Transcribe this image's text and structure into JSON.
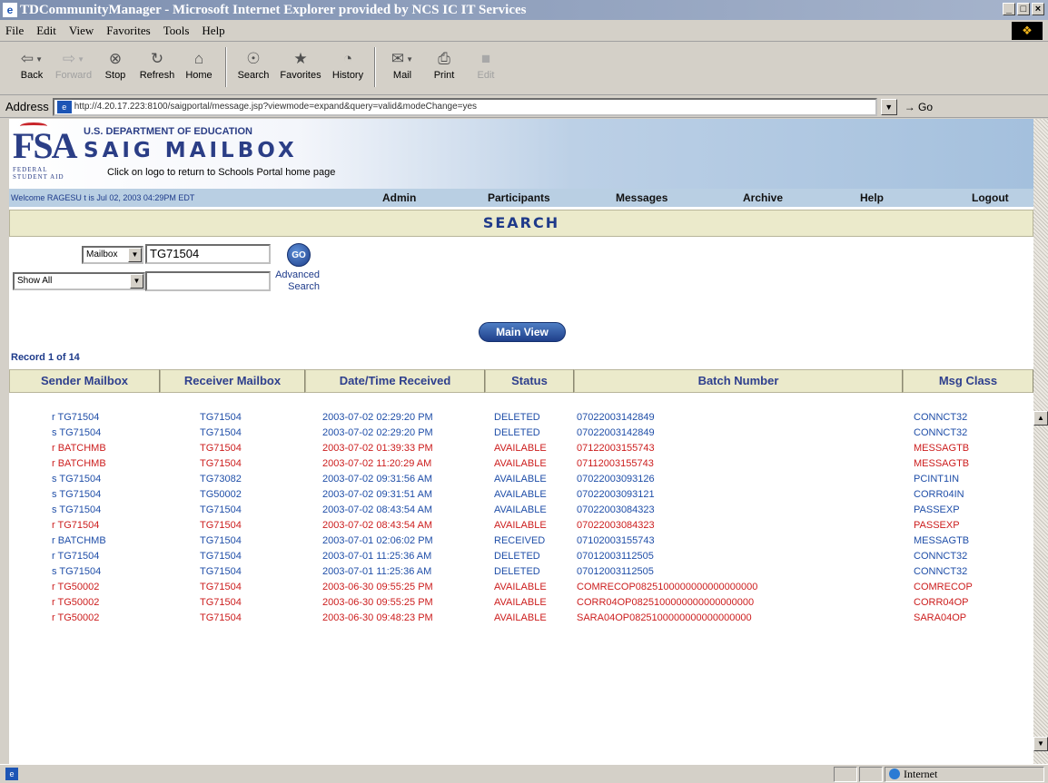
{
  "window": {
    "title": "TDCommunityManager - Microsoft Internet Explorer provided by NCS IC IT Services",
    "buttons": [
      "_",
      "□",
      "×"
    ]
  },
  "menu": [
    "File",
    "Edit",
    "View",
    "Favorites",
    "Tools",
    "Help"
  ],
  "toolbar": {
    "back": "Back",
    "forward": "Forward",
    "stop": "Stop",
    "refresh": "Refresh",
    "home": "Home",
    "search": "Search",
    "favorites": "Favorites",
    "history": "History",
    "mail": "Mail",
    "print": "Print",
    "edit": "Edit"
  },
  "address": {
    "label": "Address",
    "url": "http://4.20.17.223:8100/saigportal/message.jsp?viewmode=expand&query=valid&modeChange=yes",
    "go": "Go"
  },
  "banner": {
    "logo_big": "FSA",
    "logo_small": "FEDERAL STUDENT AID",
    "dept": "U.S. DEPARTMENT OF EDUCATION",
    "title": "SAIG MAILBOX",
    "subtitle": "Click on logo to return to Schools Portal home page"
  },
  "nav": {
    "welcome": "Welcome RAGESU    t is Jul 02, 2003 04:29PM EDT",
    "items": [
      "Admin",
      "Participants",
      "Messages",
      "Archive",
      "Help",
      "Logout"
    ]
  },
  "search": {
    "heading": "SEARCH",
    "mailbox_select": "Mailbox",
    "mailbox_value": "TG71504",
    "go": "GO",
    "filter_select": "Show All",
    "filter_value": "",
    "advanced": "Advanced Search",
    "main_view": "Main View"
  },
  "record_label": "Record 1 of 14",
  "table": {
    "headers": [
      "Sender Mailbox",
      "Receiver Mailbox",
      "Date/Time Received",
      "Status",
      "Batch Number",
      "Msg Class"
    ],
    "rows": [
      {
        "color": "blue",
        "cells": [
          "r TG71504",
          "TG71504",
          "2003-07-02 02:29:20 PM",
          "DELETED",
          "07022003142849",
          "CONNCT32"
        ]
      },
      {
        "color": "blue",
        "cells": [
          "s TG71504",
          "TG71504",
          "2003-07-02 02:29:20 PM",
          "DELETED",
          "07022003142849",
          "CONNCT32"
        ]
      },
      {
        "color": "red",
        "cells": [
          "r BATCHMB",
          "TG71504",
          "2003-07-02 01:39:33 PM",
          "AVAILABLE",
          "07122003155743",
          "MESSAGTB"
        ]
      },
      {
        "color": "red",
        "cells": [
          "r BATCHMB",
          "TG71504",
          "2003-07-02 11:20:29 AM",
          "AVAILABLE",
          "07112003155743",
          "MESSAGTB"
        ]
      },
      {
        "color": "blue",
        "cells": [
          "s TG71504",
          "TG73082",
          "2003-07-02 09:31:56 AM",
          "AVAILABLE",
          "07022003093126",
          "PCINT1IN"
        ]
      },
      {
        "color": "blue",
        "cells": [
          "s TG71504",
          "TG50002",
          "2003-07-02 09:31:51 AM",
          "AVAILABLE",
          "07022003093121",
          "CORR04IN"
        ]
      },
      {
        "color": "blue",
        "cells": [
          "s TG71504",
          "TG71504",
          "2003-07-02 08:43:54 AM",
          "AVAILABLE",
          "07022003084323",
          "PASSEXP"
        ]
      },
      {
        "color": "red",
        "cells": [
          "r TG71504",
          "TG71504",
          "2003-07-02 08:43:54 AM",
          "AVAILABLE",
          "07022003084323",
          "PASSEXP"
        ]
      },
      {
        "color": "blue",
        "cells": [
          "r BATCHMB",
          "TG71504",
          "2003-07-01 02:06:02 PM",
          "RECEIVED",
          "07102003155743",
          "MESSAGTB"
        ]
      },
      {
        "color": "blue",
        "cells": [
          "r TG71504",
          "TG71504",
          "2003-07-01 11:25:36 AM",
          "DELETED",
          "07012003112505",
          "CONNCT32"
        ]
      },
      {
        "color": "blue",
        "cells": [
          "s TG71504",
          "TG71504",
          "2003-07-01 11:25:36 AM",
          "DELETED",
          "07012003112505",
          "CONNCT32"
        ]
      },
      {
        "color": "red",
        "cells": [
          "r TG50002",
          "TG71504",
          "2003-06-30 09:55:25 PM",
          "AVAILABLE",
          "COMRECOP0825100000000000000000",
          "COMRECOP"
        ]
      },
      {
        "color": "red",
        "cells": [
          "r TG50002",
          "TG71504",
          "2003-06-30 09:55:25 PM",
          "AVAILABLE",
          "CORR04OP0825100000000000000000",
          "CORR04OP"
        ]
      },
      {
        "color": "red",
        "cells": [
          "r TG50002",
          "TG71504",
          "2003-06-30 09:48:23 PM",
          "AVAILABLE",
          "SARA04OP0825100000000000000000",
          "SARA04OP"
        ]
      }
    ]
  },
  "status": {
    "zone": "Internet"
  },
  "colors": {
    "row_blue": "#1f4ea8",
    "row_red": "#cc1d1d",
    "header_bg": "#ebeacb",
    "nav_bg": "#b9cfe3",
    "brand_navy": "#2b3e86"
  }
}
